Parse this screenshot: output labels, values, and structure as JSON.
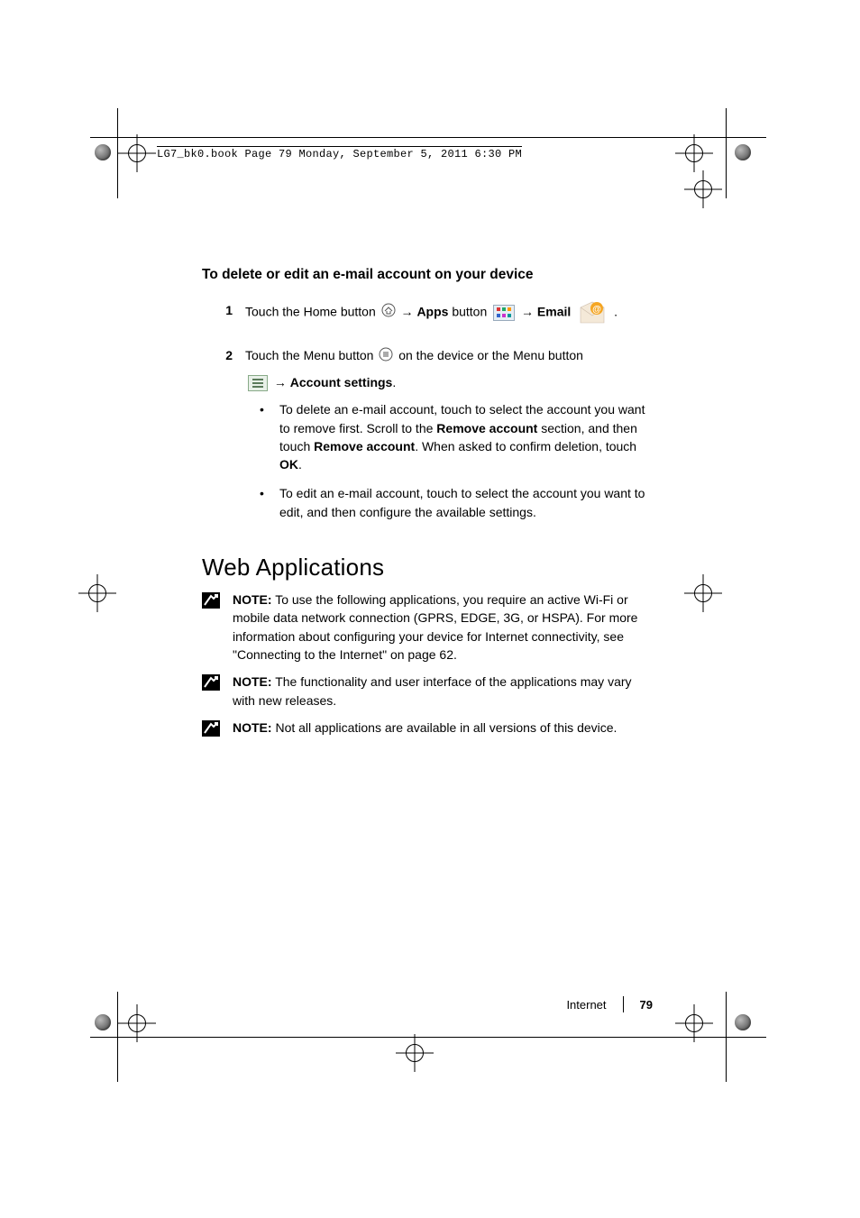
{
  "source_header": "LG7_bk0.book  Page 79  Monday, September 5, 2011  6:30 PM",
  "section_heading": "To delete or edit an e-mail account on your device",
  "steps": {
    "s1": {
      "num": "1",
      "pre": "Touch the Home button ",
      "arrow1": "→",
      "apps_bold": "Apps",
      "button_word": " button ",
      "arrow2": "→",
      "email_bold": "Email",
      "trail": " ."
    },
    "s2": {
      "num": "2",
      "line1": "Touch the Menu button ",
      "line1_trail": " on the device or the Menu button",
      "arrow": "→",
      "acct_settings_bold": "Account settings",
      "period": ".",
      "bullet1": {
        "a": "To delete an e-mail account, touch to select the account you want to remove first. Scroll to the ",
        "b_bold": "Remove account",
        "c": " section, and then touch ",
        "d_bold": "Remove account",
        "e": ". When asked to confirm deletion, touch ",
        "f_bold": "OK",
        "g": "."
      },
      "bullet2": "To edit an e-mail account, touch to select the account you want to edit, and then configure the available settings."
    }
  },
  "main_heading": "Web Applications",
  "notes": {
    "label": "NOTE:",
    "n1": " To use the following applications, you require an active Wi-Fi or mobile data network connection (GPRS, EDGE, 3G, or HSPA). For more information about configuring your device for Internet connectivity, see \"Connecting to the Internet\" on page 62.",
    "n2": " The functionality and user interface of the applications may vary with new releases.",
    "n3": " Not all applications are available in all versions of this device."
  },
  "footer": {
    "section": "Internet",
    "page": "79"
  }
}
